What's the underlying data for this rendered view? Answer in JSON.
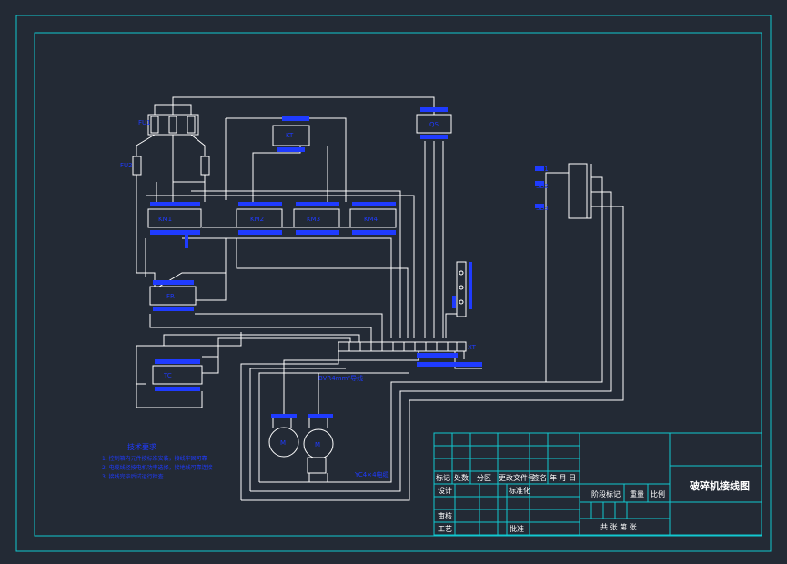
{
  "drawing": {
    "title": "破碎机接线图",
    "notes_title": "技术要求",
    "notes": [
      "1. 控制箱内元件按标准安装，接线牢固可靠",
      "2. 电缆线径按电机功率选择，接地线可靠连接",
      "3. 接线完毕后试运行检查"
    ],
    "labels": {
      "fu1": "FU1",
      "fu2": "FU2",
      "fr": "FR",
      "qs": "QS",
      "km1": "KM1",
      "km2": "KM2",
      "km3": "KM3",
      "km4": "KM4",
      "tc": "TC",
      "kt": "KT",
      "sb1": "SB1",
      "sb2": "SB2",
      "sb3": "SB3",
      "motor_m1": "M",
      "motor_m2": "M",
      "terminal": "XT",
      "cable1": "BVR4mm²导线",
      "cable2": "YC4×4电缆"
    },
    "title_block": {
      "row_mark": [
        "标记",
        "处数",
        "分区",
        "更改文件号",
        "签名",
        "年 月 日"
      ],
      "design": "设计",
      "standard": "标准化",
      "review": "审核",
      "process": "工艺",
      "approve": "批准",
      "stage": "阶段标记",
      "weight": "重量",
      "scale": "比例",
      "sheets": "共 张  第 张"
    }
  }
}
